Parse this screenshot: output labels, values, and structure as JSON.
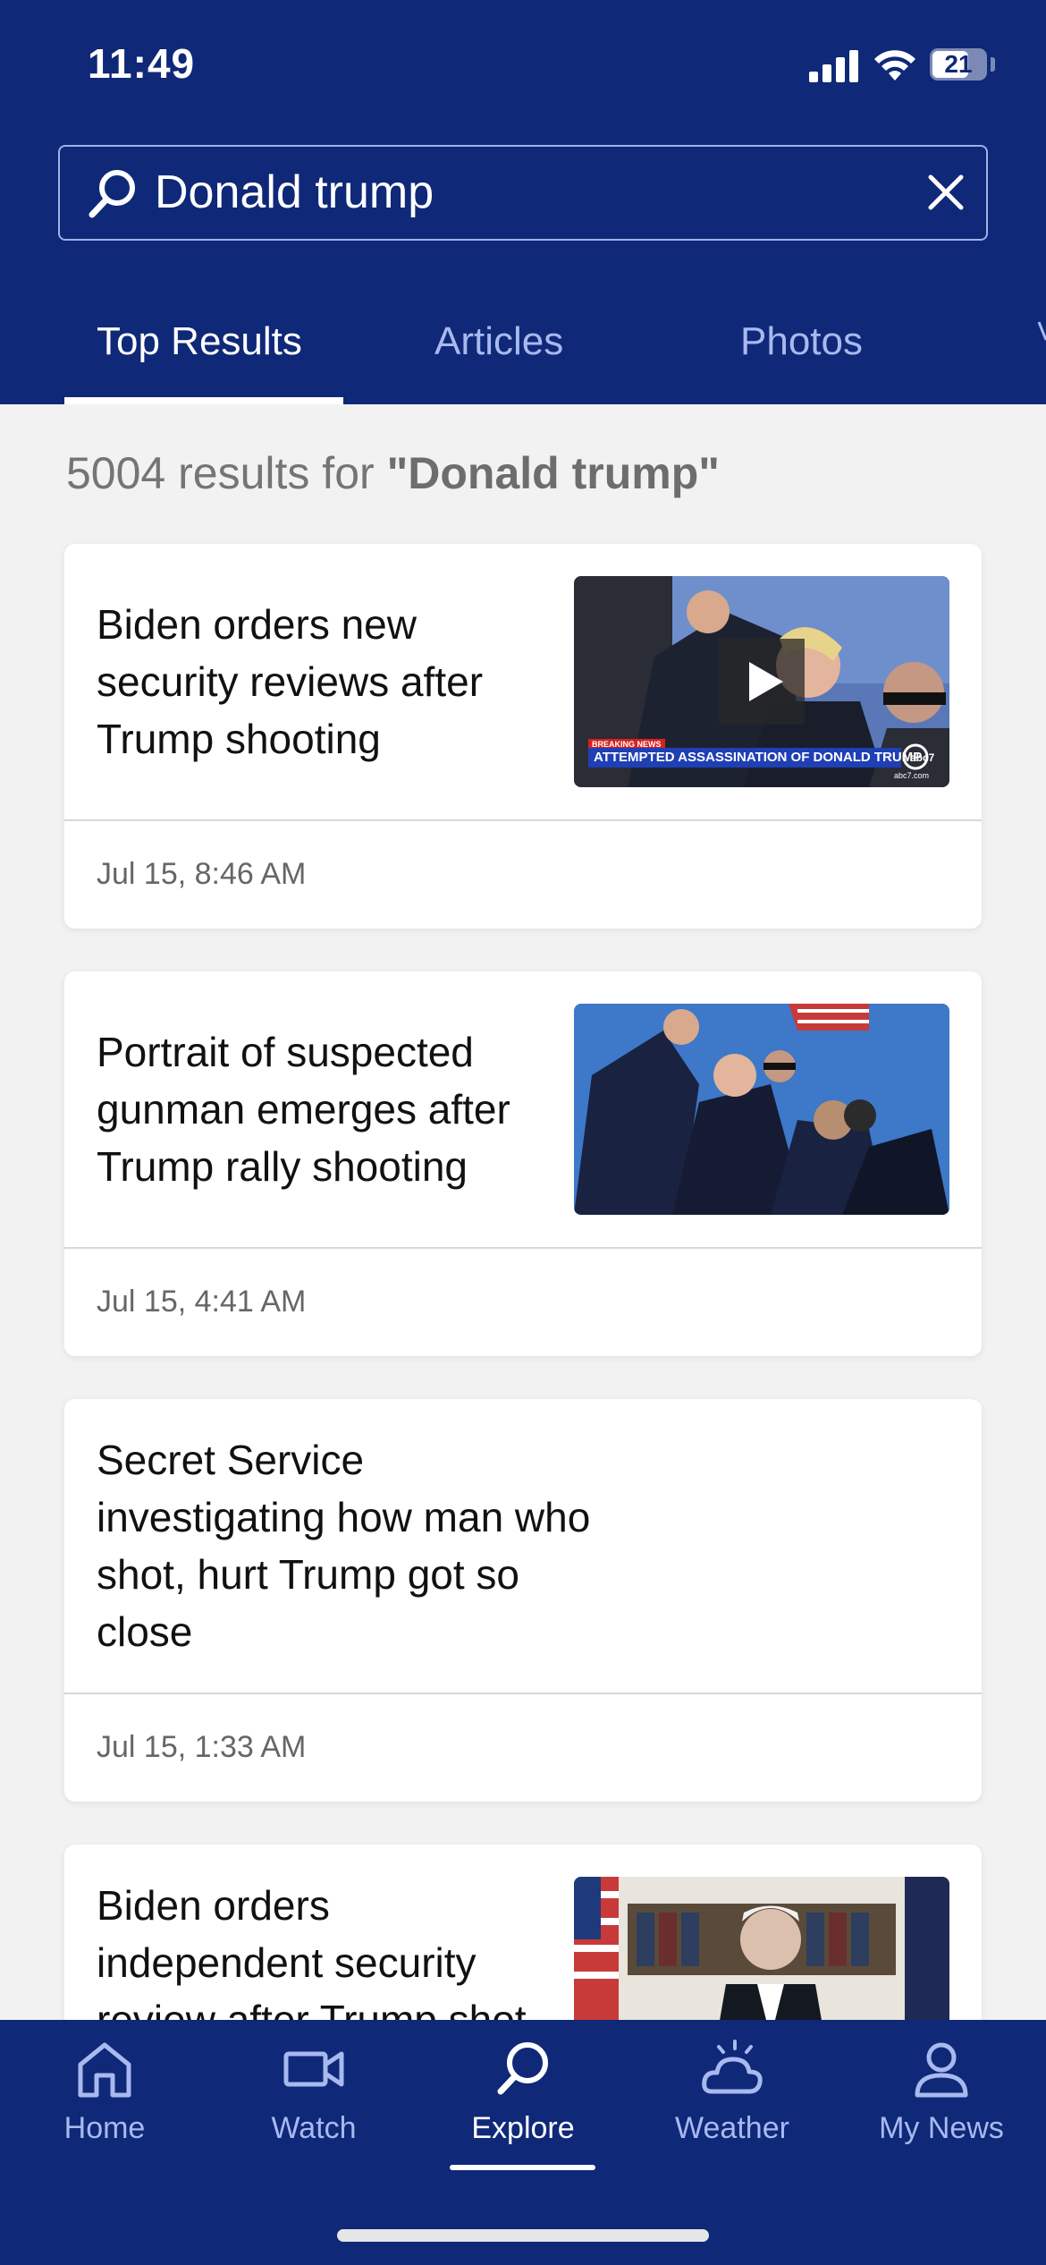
{
  "status_bar": {
    "time": "11:49",
    "battery": "21"
  },
  "search": {
    "query": "Donald trump"
  },
  "tabs": [
    {
      "label": "Top Results",
      "active": true
    },
    {
      "label": "Articles",
      "active": false
    },
    {
      "label": "Photos",
      "active": false
    }
  ],
  "results": {
    "count": "5004",
    "prefix": "results for",
    "query_quoted": "\"Donald trump\""
  },
  "articles": [
    {
      "title": "Biden orders new security reviews after Trump shooting",
      "date": "Jul 15, 8:46 AM",
      "thumbnail": "video",
      "video_overlay": {
        "badge": "BREAKING NEWS",
        "ticker": "ATTEMPTED ASSASSINATION OF DONALD TRUMP",
        "logo": "abc7",
        "logo_sub": "abc7.com"
      }
    },
    {
      "title": "Portrait of suspected gunman emerges after Trump rally shooting",
      "date": "Jul 15, 4:41 AM",
      "thumbnail": "photo"
    },
    {
      "title": "Secret Service investigating how man who shot, hurt Trump got so close",
      "date": "Jul 15, 1:33 AM",
      "thumbnail": null
    },
    {
      "title": "Biden orders independent security review after Trump shot",
      "date": "",
      "thumbnail": "photo"
    }
  ],
  "bottom_nav": [
    {
      "label": "Home",
      "icon": "home-icon",
      "active": false
    },
    {
      "label": "Watch",
      "icon": "video-camera-icon",
      "active": false
    },
    {
      "label": "Explore",
      "icon": "search-icon",
      "active": true
    },
    {
      "label": "Weather",
      "icon": "weather-sun-cloud-icon",
      "active": false
    },
    {
      "label": "My News",
      "icon": "person-icon",
      "active": false
    }
  ],
  "colors": {
    "header_bg": "#0f2878",
    "tab_inactive": "#a8b9ef",
    "card_bg": "#ffffff",
    "page_bg": "#f2f2f2"
  }
}
